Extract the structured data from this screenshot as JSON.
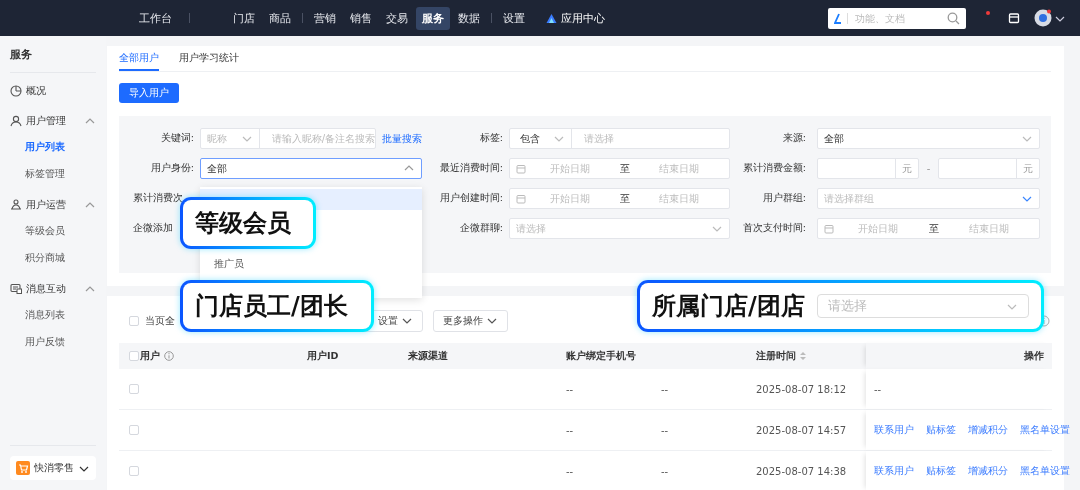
{
  "topbar": {
    "nav_groups": [
      [
        {
          "label": "工作台",
          "selected": false
        }
      ],
      [
        {
          "label": "门店",
          "selected": false
        },
        {
          "label": "商品",
          "selected": false
        }
      ],
      [
        {
          "label": "营销",
          "selected": false
        },
        {
          "label": "销售",
          "selected": false
        },
        {
          "label": "交易",
          "selected": false
        },
        {
          "label": "服务",
          "selected": true
        },
        {
          "label": "数据",
          "selected": false
        }
      ],
      [
        {
          "label": "设置",
          "selected": false
        }
      ]
    ],
    "app_center": "应用中心",
    "search": {
      "placeholder": "功能、文档"
    },
    "notification_dot": true
  },
  "sidebar": {
    "title": "服务",
    "items": [
      {
        "label": "概况"
      },
      {
        "label": "用户管理",
        "expanded": true,
        "children": [
          {
            "label": "用户列表",
            "selected": true
          },
          {
            "label": "标签管理",
            "selected": false
          }
        ]
      },
      {
        "label": "用户运营",
        "expanded": true,
        "children": [
          {
            "label": "等级会员",
            "selected": false
          },
          {
            "label": "积分商城",
            "selected": false
          }
        ]
      },
      {
        "label": "消息互动",
        "expanded": true,
        "children": [
          {
            "label": "消息列表",
            "selected": false
          },
          {
            "label": "用户反馈",
            "selected": false
          }
        ]
      }
    ],
    "footer": "快消零售"
  },
  "tabs": [
    {
      "label": "全部用户",
      "selected": true
    },
    {
      "label": "用户学习统计",
      "selected": false
    }
  ],
  "import_button": "导入用户",
  "filters": [
    {
      "kind": "keyword",
      "label": "关键词:",
      "select": "昵称",
      "placeholder": "请输入昵称/备注名搜索",
      "link": "批量搜索"
    },
    {
      "kind": "tag",
      "label": "标签:",
      "select": "包含",
      "placeholder": "请选择"
    },
    {
      "kind": "select",
      "label": "来源:",
      "value": "全部",
      "open": false,
      "accent": false
    },
    {
      "kind": "select",
      "label": "用户身份:",
      "value": "全部",
      "open": true,
      "accent": false
    },
    {
      "kind": "date_range",
      "label": "最近消费时间:",
      "start": "开始日期",
      "separator": "至",
      "end": "结束日期"
    },
    {
      "kind": "amount_range",
      "label": "累计消费金额:",
      "unit_from": "元",
      "separator": "-",
      "unit_to": "元"
    },
    {
      "kind": "label_only",
      "label": "累计消费次"
    },
    {
      "kind": "date_range",
      "label": "用户创建时间:",
      "start": "开始日期",
      "separator": "至",
      "end": "结束日期"
    },
    {
      "kind": "select",
      "label": "用户群组:",
      "placeholder": "请选择群组",
      "open": false,
      "accent": true
    },
    {
      "kind": "label_only",
      "label": "企微添加"
    },
    {
      "kind": "select",
      "label": "企微群聊:",
      "placeholder": "请选择",
      "open": false,
      "accent": false
    },
    {
      "kind": "date_range",
      "label": "首次支付时间:",
      "start": "开始日期",
      "separator": "至",
      "end": "结束日期"
    }
  ],
  "dropdown": {
    "options": [
      {
        "selected": true
      },
      {
        "selected": false
      },
      {
        "label": "推广员",
        "selected": false
      }
    ]
  },
  "toolbar": {
    "select_all": "当页全",
    "checked": false,
    "buttons": [
      "设置",
      "更多操作"
    ]
  },
  "table": {
    "header_checked": false,
    "columns": [
      {
        "label": "用户",
        "info": true
      },
      {
        "label": "用户ID"
      },
      {
        "label": "来源渠道"
      },
      {
        "label": "账户绑定手机号"
      },
      {},
      {
        "label": "注册时间",
        "sortable": true
      }
    ],
    "action_header": "操作",
    "rows": [
      {
        "checked": false,
        "cells": [
          "",
          "",
          "",
          "--",
          "--",
          "2025-08-07 18:12"
        ],
        "actions": [],
        "empty_action": "--"
      },
      {
        "checked": false,
        "cells": [
          "",
          "",
          "",
          "--",
          "--",
          "2025-08-07 14:57"
        ],
        "actions": [
          "联系用户",
          "贴标签",
          "增减积分",
          "黑名单设置"
        ]
      },
      {
        "checked": false,
        "cells": [
          "",
          "",
          "",
          "--",
          "--",
          "2025-08-07 14:38"
        ],
        "actions": [
          "联系用户",
          "贴标签",
          "增减积分",
          "黑名单设置"
        ]
      }
    ]
  },
  "callouts": [
    {
      "kind": "text",
      "text": "等级会员"
    },
    {
      "kind": "text",
      "text": "门店员工/团长"
    },
    {
      "kind": "select",
      "text": "所属门店/团店",
      "placeholder": "请选择"
    }
  ]
}
